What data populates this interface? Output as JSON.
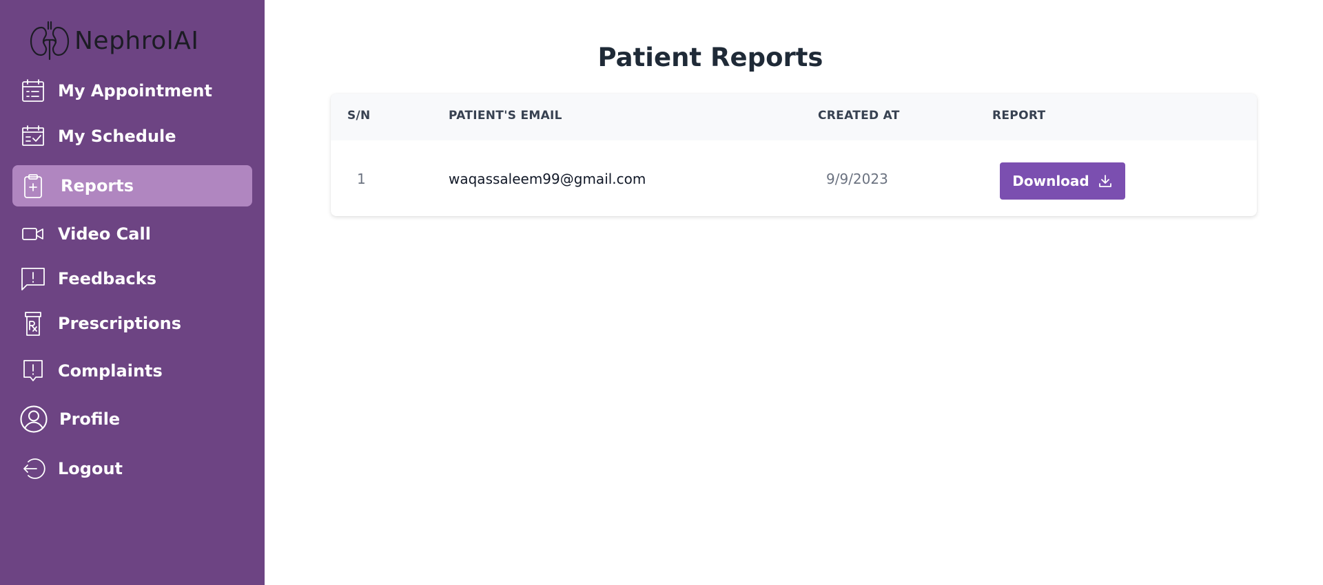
{
  "app": {
    "logo_text": "NephrolAI"
  },
  "sidebar": {
    "items": [
      {
        "label": "My Appointment",
        "icon": "calendar-icon"
      },
      {
        "label": "My Schedule",
        "icon": "calendar-check-icon"
      },
      {
        "label": "Reports",
        "icon": "clipboard-plus-icon",
        "active": true
      },
      {
        "label": "Video Call",
        "icon": "video-icon"
      },
      {
        "label": "Feedbacks",
        "icon": "message-alert-icon"
      },
      {
        "label": "Prescriptions",
        "icon": "rx-bottle-icon"
      },
      {
        "label": "Complaints",
        "icon": "alert-bubble-icon"
      },
      {
        "label": "Profile",
        "icon": "user-circle-icon"
      },
      {
        "label": "Logout",
        "icon": "logout-icon"
      }
    ]
  },
  "main": {
    "title": "Patient Reports",
    "table": {
      "headers": [
        "S/N",
        "PATIENT'S EMAIL",
        "CREATED AT",
        "REPORT"
      ],
      "rows": [
        {
          "sn": "1",
          "email": "waqassaleem99@gmail.com",
          "created_at": "9/9/2023",
          "action_label": "Download"
        }
      ]
    }
  },
  "colors": {
    "sidebar_bg": "#6d4483",
    "active_item_bg": "#b086c0",
    "button_bg": "#7b4fb0",
    "header_bg": "#f8f9fb"
  }
}
